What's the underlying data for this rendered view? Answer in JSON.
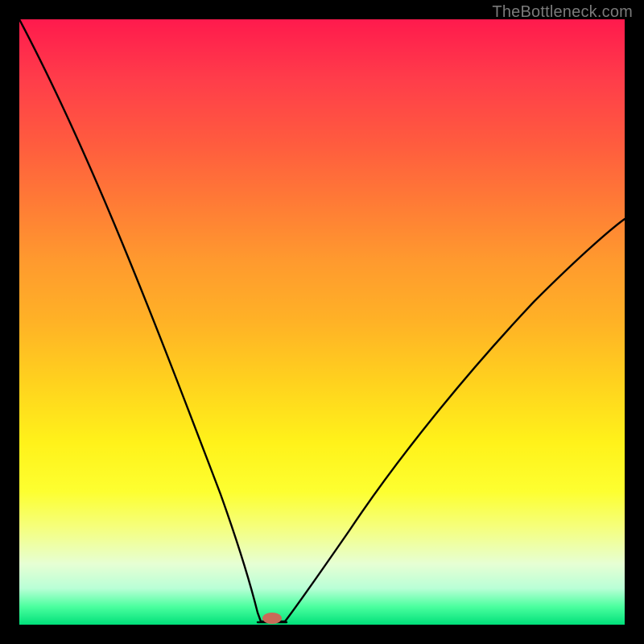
{
  "watermark": "TheBottleneck.com",
  "chart_data": {
    "type": "line",
    "title": "",
    "xlabel": "",
    "ylabel": "",
    "x_range": [
      0,
      100
    ],
    "y_range": [
      0,
      100
    ],
    "grid": false,
    "legend": false,
    "series": [
      {
        "name": "bottleneck-curve",
        "stroke": "#000000",
        "x": [
          0,
          5,
          10,
          15,
          20,
          25,
          30,
          33,
          36,
          38,
          39,
          40,
          41,
          44,
          47,
          52,
          58,
          65,
          72,
          80,
          88,
          95,
          100
        ],
        "y": [
          100,
          85,
          71,
          58,
          47,
          36,
          24,
          16,
          9,
          4,
          2,
          0,
          0,
          0,
          3,
          8,
          16,
          25,
          34,
          44,
          53,
          60,
          65
        ]
      }
    ],
    "marker": {
      "name": "optimal-point",
      "x": 40,
      "y": 0,
      "color": "#c96a58",
      "rx": 8,
      "ry": 5
    },
    "background_gradient_stops": [
      {
        "pos": 0.0,
        "color": "#ff1a4d"
      },
      {
        "pos": 0.5,
        "color": "#ffb226"
      },
      {
        "pos": 0.8,
        "color": "#fdff30"
      },
      {
        "pos": 1.0,
        "color": "#00e07a"
      }
    ]
  }
}
